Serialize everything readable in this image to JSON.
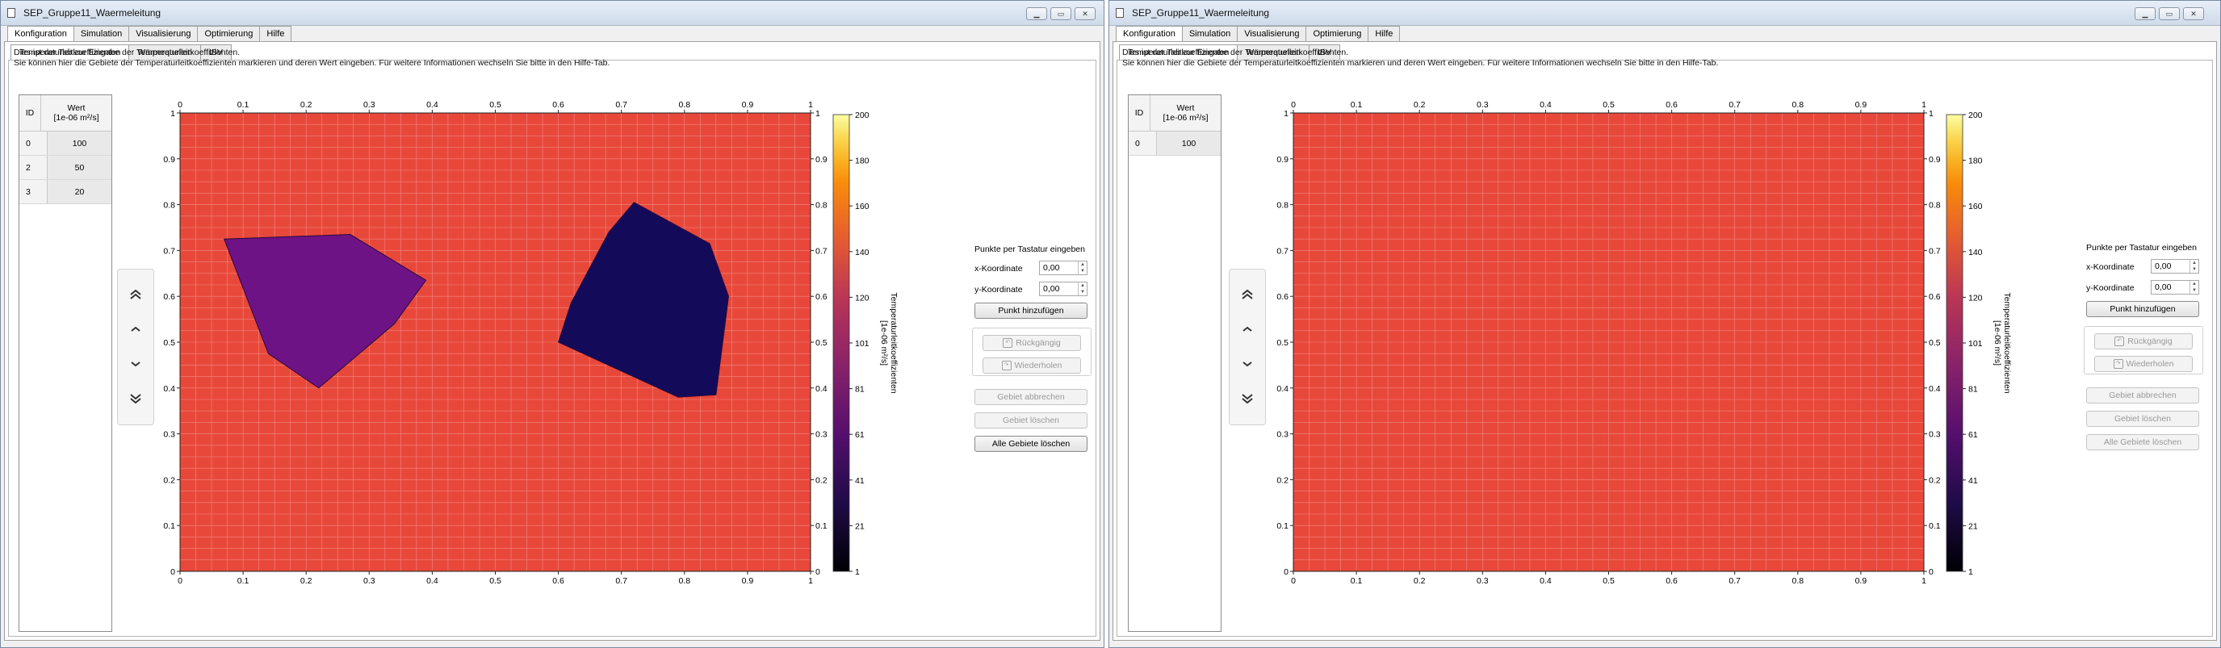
{
  "windows": [
    {
      "title": "SEP_Gruppe11_Waermeleitung",
      "tabs": [
        "Konfiguration",
        "Simulation",
        "Visualisierung",
        "Optimierung",
        "Hilfe"
      ],
      "subtabs": [
        "Temperaturleitkoeffizienten",
        "Wärmequellen",
        "IBV"
      ],
      "desc_line1": "Dies ist der Tab zur Eingabe der Temperaturleitkoeffizienten.",
      "desc_line2": "Sie können hier die Gebiete der Temperaturleitkoeffizienten markieren und deren Wert eingeben. Für weitere Informationen wechseln Sie bitte in den Hilfe-Tab.",
      "table": {
        "col_id": "ID",
        "col_value_line1": "Wert",
        "col_value_line2": "[1e-06 m²/s]",
        "rows": [
          {
            "id": "0",
            "value": "100"
          },
          {
            "id": "2",
            "value": "50"
          },
          {
            "id": "3",
            "value": "20"
          }
        ]
      },
      "plot": {
        "x_ticks": [
          "0",
          "0.1",
          "0.2",
          "0.3",
          "0.4",
          "0.5",
          "0.6",
          "0.7",
          "0.8",
          "0.9",
          "1"
        ],
        "y_ticks": [
          "0",
          "0.1",
          "0.2",
          "0.3",
          "0.4",
          "0.5",
          "0.6",
          "0.7",
          "0.8",
          "0.9",
          "1"
        ],
        "background_value": 100,
        "regions": [
          {
            "id": "2",
            "value": 50,
            "points": [
              [
                0.07,
                0.725
              ],
              [
                0.27,
                0.735
              ],
              [
                0.39,
                0.635
              ],
              [
                0.34,
                0.54
              ],
              [
                0.22,
                0.4
              ],
              [
                0.14,
                0.475
              ]
            ]
          },
          {
            "id": "3",
            "value": 20,
            "points": [
              [
                0.72,
                0.805
              ],
              [
                0.84,
                0.715
              ],
              [
                0.87,
                0.6
              ],
              [
                0.85,
                0.385
              ],
              [
                0.79,
                0.38
              ],
              [
                0.6,
                0.5
              ],
              [
                0.62,
                0.585
              ],
              [
                0.68,
                0.74
              ]
            ]
          }
        ]
      },
      "colorbar": {
        "ticks": [
          "200",
          "180",
          "160",
          "140",
          "120",
          "101",
          "81",
          "61",
          "41",
          "21",
          "1"
        ],
        "label": "Temperaturleitkoeffizienten",
        "unit": "[1e-06 m²/s]"
      },
      "controls": {
        "title": "Punkte per Tastatur eingeben",
        "x_label": "x-Koordinate",
        "x_value": "0,00",
        "y_label": "y-Koordinate",
        "y_value": "0,00",
        "add_point": "Punkt hinzufügen",
        "undo": "Rückgängig",
        "redo": "Wiederholen",
        "cancel_area": "Gebiet abbrechen",
        "delete_area": "Gebiet löschen",
        "delete_all": "Alle Gebiete löschen",
        "delete_all_enabled": true
      }
    },
    {
      "title": "SEP_Gruppe11_Waermeleitung",
      "tabs": [
        "Konfiguration",
        "Simulation",
        "Visualisierung",
        "Optimierung",
        "Hilfe"
      ],
      "subtabs": [
        "Temperaturleitkoeffizienten",
        "Wärmequellen",
        "IBV"
      ],
      "desc_line1": "Dies ist der Tab zur Eingabe der Temperaturleitkoeffizienten.",
      "desc_line2": "Sie können hier die Gebiete der Temperaturleitkoeffizienten markieren und deren Wert eingeben. Für weitere Informationen wechseln Sie bitte in den Hilfe-Tab.",
      "table": {
        "col_id": "ID",
        "col_value_line1": "Wert",
        "col_value_line2": "[1e-06 m²/s]",
        "rows": [
          {
            "id": "0",
            "value": "100"
          }
        ]
      },
      "plot": {
        "x_ticks": [
          "0",
          "0.1",
          "0.2",
          "0.3",
          "0.4",
          "0.5",
          "0.6",
          "0.7",
          "0.8",
          "0.9",
          "1"
        ],
        "y_ticks": [
          "0",
          "0.1",
          "0.2",
          "0.3",
          "0.4",
          "0.5",
          "0.6",
          "0.7",
          "0.8",
          "0.9",
          "1"
        ],
        "background_value": 100,
        "regions": []
      },
      "colorbar": {
        "ticks": [
          "200",
          "180",
          "160",
          "140",
          "120",
          "101",
          "81",
          "61",
          "41",
          "21",
          "1"
        ],
        "label": "Temperaturleitkoeffizienten",
        "unit": "[1e-06 m²/s]"
      },
      "controls": {
        "title": "Punkte per Tastatur eingeben",
        "x_label": "x-Koordinate",
        "x_value": "0,00",
        "y_label": "y-Koordinate",
        "y_value": "0,00",
        "add_point": "Punkt hinzufügen",
        "undo": "Rückgängig",
        "redo": "Wiederholen",
        "cancel_area": "Gebiet abbrechen",
        "delete_area": "Gebiet löschen",
        "delete_all": "Alle Gebiete löschen",
        "delete_all_enabled": false
      }
    }
  ],
  "colors": {
    "background_region": "#e8483a",
    "region_50": "#6e1385",
    "region_20": "#140a5a",
    "grid": "#f08a80"
  }
}
